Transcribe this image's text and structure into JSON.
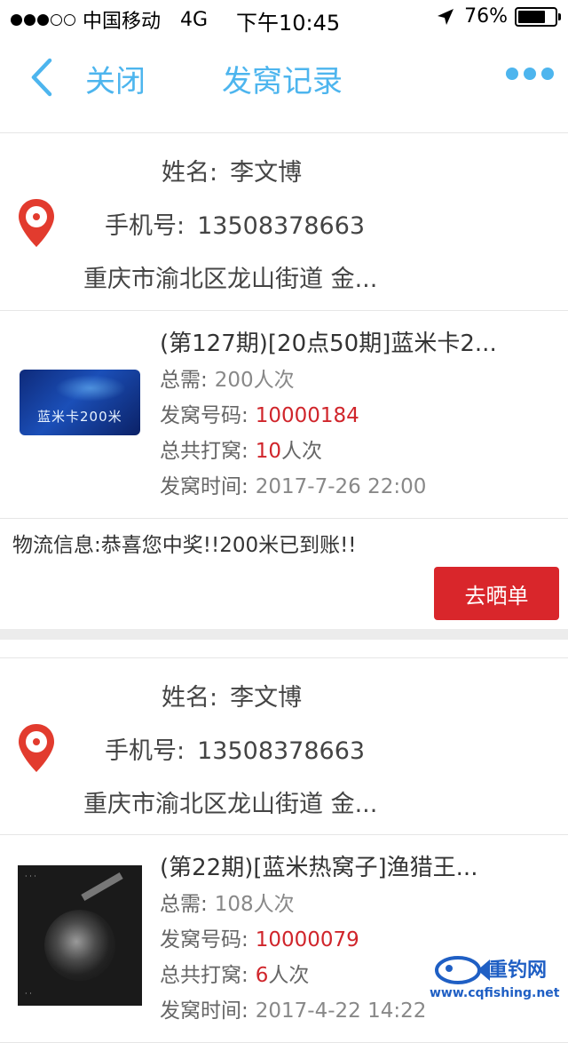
{
  "status_bar": {
    "carrier": "中国移动",
    "network": "4G",
    "time": "下午10:45",
    "battery": "76%",
    "battery_level": 0.76,
    "signal_bars_filled": 3,
    "signal_bars_total": 5
  },
  "nav": {
    "close_label": "关闭",
    "title": "发窝记录",
    "accent_color": "#4db5ee"
  },
  "records": [
    {
      "name_label": "姓名:",
      "name": "李文博",
      "phone_label": "手机号:",
      "phone": "13508378663",
      "address": "重庆市渝北区龙山街道 金...",
      "product": {
        "title": "(第127期)[20点50期]蓝米卡2...",
        "image_text": "蓝米卡200米",
        "total_label": "总需:",
        "total_value": "200人次",
        "code_label": "发窝号码:",
        "code_value": "10000184",
        "count_label": "总共打窝:",
        "count_value": "10",
        "count_unit": "人次",
        "time_label": "发窝时间:",
        "time_value": "2017-7-26 22:00"
      },
      "logistics": "物流信息:恭喜您中奖!!200米已到账!!",
      "show_button": "去晒单"
    },
    {
      "name_label": "姓名:",
      "name": "李文博",
      "phone_label": "手机号:",
      "phone": "13508378663",
      "address": "重庆市渝北区龙山街道 金...",
      "product": {
        "title": "(第22期)[蓝米热窝子]渔猎王...",
        "total_label": "总需:",
        "total_value": "108人次",
        "code_label": "发窝号码:",
        "code_value": "10000079",
        "count_label": "总共打窝:",
        "count_value": "6",
        "count_unit": "人次",
        "time_label": "发窝时间:",
        "time_value": "2017-4-22 14:22"
      }
    }
  ],
  "watermark": {
    "title": "重钓网",
    "url": "www.cqfishing.net"
  },
  "colors": {
    "accent": "#4db5ee",
    "highlight_red": "#d0252b",
    "button_red": "#d9262b"
  }
}
